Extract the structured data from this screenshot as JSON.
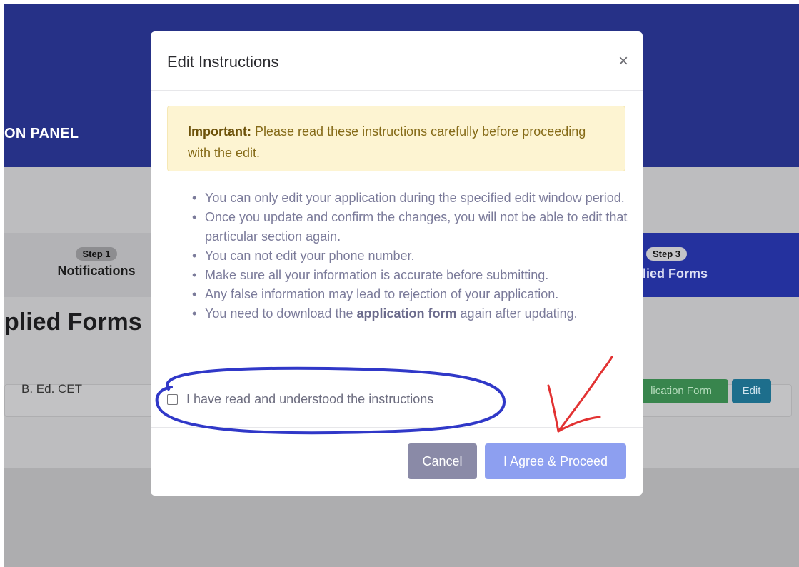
{
  "background": {
    "panel_title": "ON PANEL",
    "steps": {
      "step1_pill": "Step 1",
      "step1_label": "Notifications",
      "step3_pill": "Step 3",
      "step3_label": "lied Forms"
    },
    "applied_heading": "plied Forms",
    "form_row": {
      "name": "B. Ed. CET",
      "application_form_button": "lication Form",
      "edit_button": "Edit"
    }
  },
  "modal": {
    "title": "Edit Instructions",
    "close_icon": "×",
    "alert": {
      "strong": "Important:",
      "text": " Please read these instructions carefully before proceeding with the edit."
    },
    "instructions": {
      "item1": "You can only edit your application during the specified edit window period.",
      "item2": "Once you update and confirm the changes, you will not be able to edit that particular section again.",
      "item3": "You can not edit your phone number.",
      "item4": "Make sure all your information is accurate before submitting.",
      "item5": "Any false information may lead to rejection of your application.",
      "item6_prefix": "You need to download the ",
      "item6_bold": "application form",
      "item6_suffix": " again after updating."
    },
    "checkbox_label": "I have read and understood the instructions",
    "cancel_button": "Cancel",
    "proceed_button": "I Agree & Proceed"
  },
  "colors": {
    "header": "#263187",
    "step3_active": "#24319e",
    "alert_bg": "#fdf4d2",
    "proceed_button": "#8d9ff0",
    "cancel_button": "#8a8aa7",
    "annotation_blue": "#3038c8",
    "annotation_red": "#e23232"
  }
}
